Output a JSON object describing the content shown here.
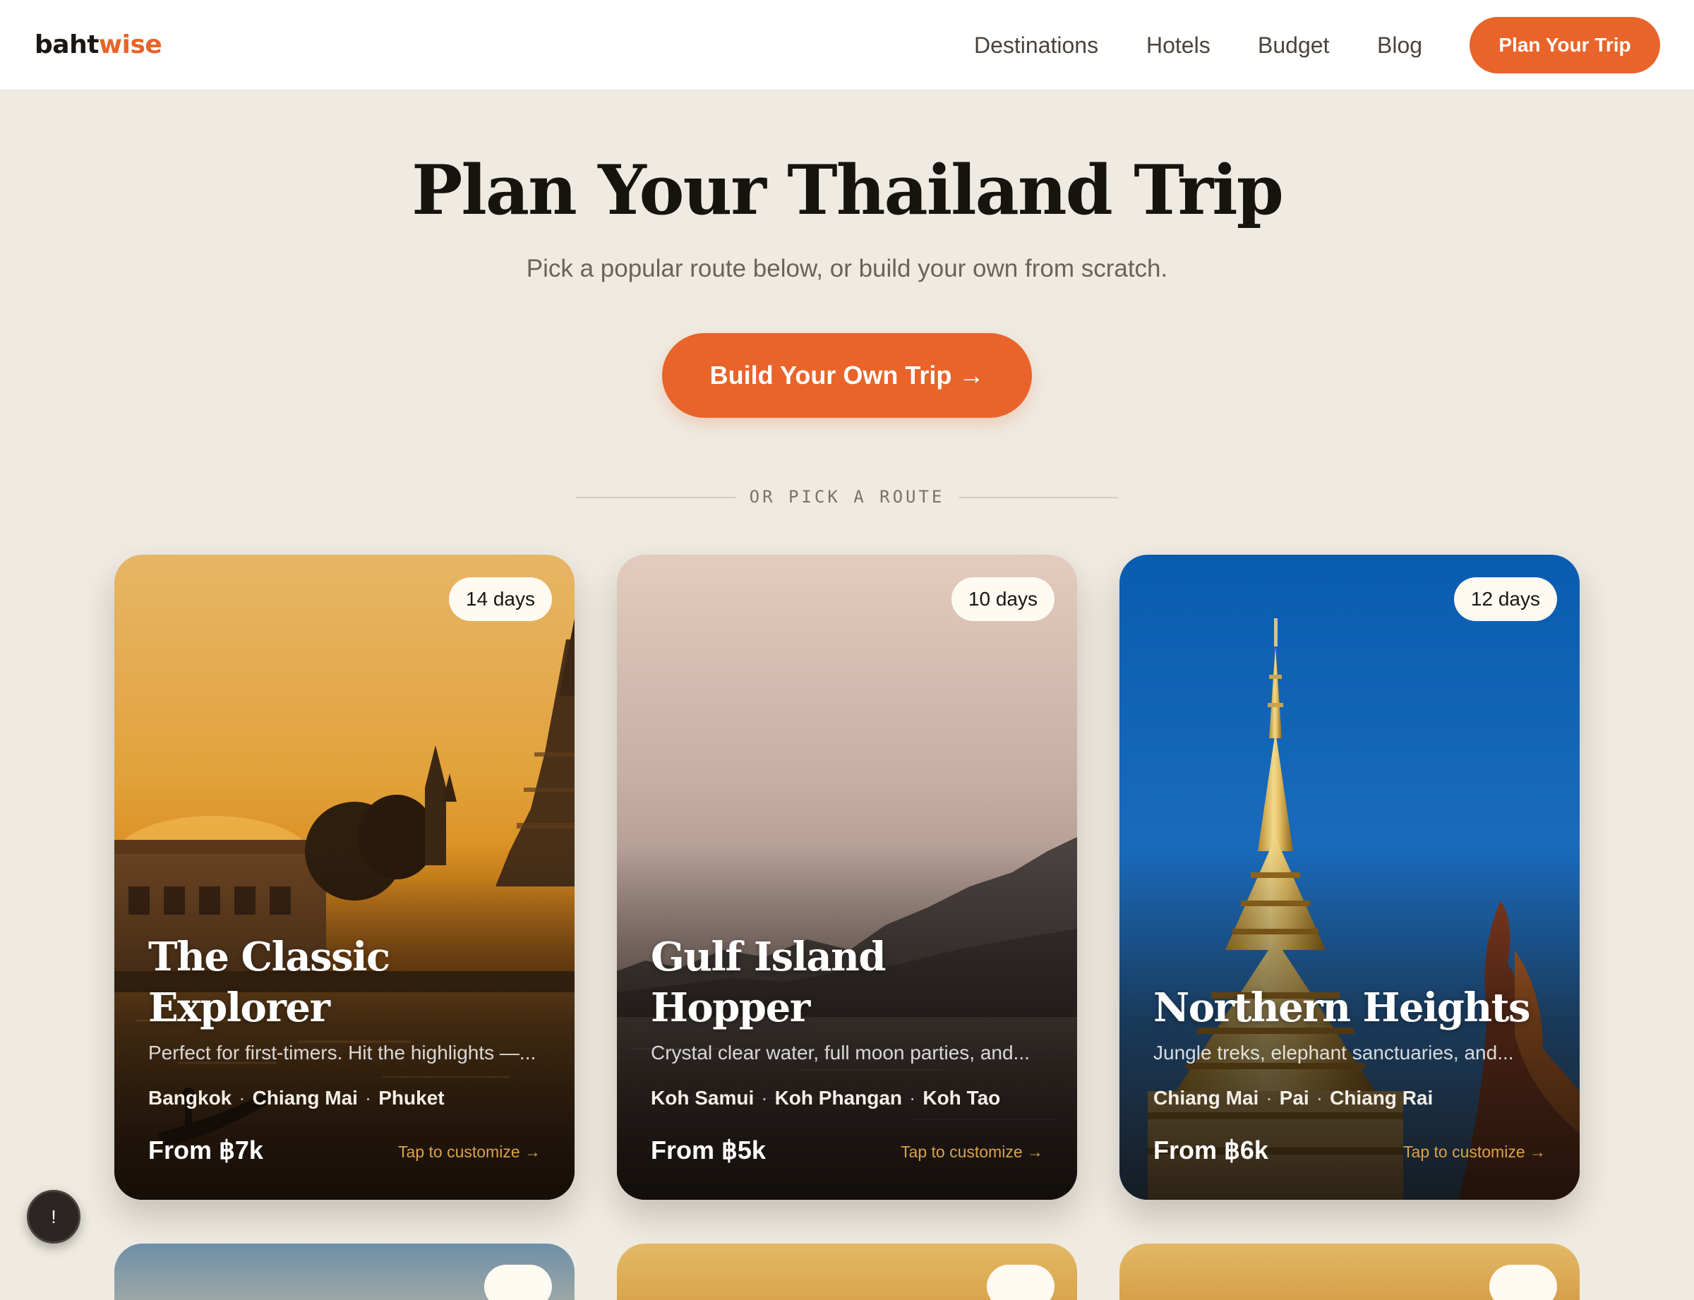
{
  "brand": {
    "part1": "baht",
    "part2": "wise",
    "accent_color": "#e8642a"
  },
  "nav": {
    "links": [
      "Destinations",
      "Hotels",
      "Budget",
      "Blog"
    ],
    "cta_label": "Plan Your Trip"
  },
  "hero": {
    "title": "Plan Your Thailand Trip",
    "subtitle": "Pick a popular route below, or build your own from scratch.",
    "cta_label": "Build Your Own Trip →",
    "divider_label": "OR PICK A ROUTE"
  },
  "routes": [
    {
      "days": "14 days",
      "title": "The Classic Explorer",
      "description": "Perfect for first-timers. Hit the highlights —...",
      "cities": [
        "Bangkok",
        "Chiang Mai",
        "Phuket"
      ],
      "price": "From ฿7k",
      "tap_label": "Tap to customize →",
      "image_icon": "temple-sunset-photo"
    },
    {
      "days": "10 days",
      "title": "Gulf Island Hopper",
      "description": "Crystal clear water, full moon parties, and...",
      "cities": [
        "Koh Samui",
        "Koh Phangan",
        "Koh Tao"
      ],
      "price": "From ฿5k",
      "tap_label": "Tap to customize →",
      "image_icon": "island-dusk-photo"
    },
    {
      "days": "12 days",
      "title": "Northern Heights",
      "description": "Jungle treks, elephant sanctuaries, and...",
      "cities": [
        "Chiang Mai",
        "Pai",
        "Chiang Rai"
      ],
      "price": "From ฿6k",
      "tap_label": "Tap to customize →",
      "image_icon": "golden-stupa-photo"
    }
  ],
  "chat_button": {
    "icon": "chat-icon",
    "glyph": "!"
  }
}
